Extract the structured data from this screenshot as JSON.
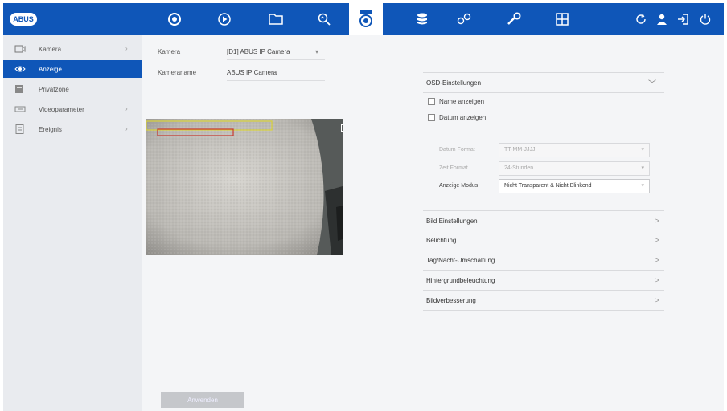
{
  "topbar": {
    "logo": "ABUS",
    "nav": [
      {
        "name": "camera-settings-icon"
      },
      {
        "name": "playback-icon"
      },
      {
        "name": "folder-icon"
      },
      {
        "name": "search-icon"
      },
      {
        "name": "webcam-icon",
        "active": true
      },
      {
        "name": "storage-icon"
      },
      {
        "name": "system-settings-icon"
      },
      {
        "name": "maintenance-icon"
      },
      {
        "name": "layout-icon"
      }
    ],
    "right_icons": [
      "refresh-icon",
      "user-icon",
      "logout-icon",
      "power-icon"
    ]
  },
  "sidebar": {
    "items": [
      {
        "label": "Kamera",
        "icon": "camera-icon",
        "chevron": "›",
        "active": false
      },
      {
        "label": "Anzeige",
        "icon": "eye-icon",
        "chevron": "",
        "active": true
      },
      {
        "label": "Privatzone",
        "icon": "privacy-zone-icon",
        "chevron": "",
        "active": false
      },
      {
        "label": "Videoparameter",
        "icon": "video-params-icon",
        "chevron": "›",
        "active": false
      },
      {
        "label": "Ereignis",
        "icon": "event-icon",
        "chevron": "›",
        "active": false
      }
    ]
  },
  "main": {
    "camera_label": "Kamera",
    "camera_value": "[D1] ABUS IP Camera",
    "camera_arrow": "▾",
    "camera_name_label": "Kameraname",
    "camera_name_value": "ABUS IP Camera",
    "save_label": "Anwenden"
  },
  "osd": {
    "title": "OSD-Einstellungen",
    "arrow": "﹀",
    "show_name": "Name anzeigen",
    "show_date": "Datum anzeigen",
    "date_format_label": "Datum Format",
    "date_format_value": "TT-MM-JJJJ",
    "time_format_label": "Zeit Format",
    "time_format_value": "24-Stunden",
    "display_mode_label": "Anzeige Modus",
    "display_mode_value": "Nicht Transparent & Nicht Blinkend",
    "select_arrow": "▾"
  },
  "sections": [
    {
      "label": "Bild Einstellungen",
      "arrow": ">"
    },
    {
      "label": "Belichtung",
      "arrow": ">"
    },
    {
      "label": "Tag/Nacht-Umschaltung",
      "arrow": ">"
    },
    {
      "label": "Hintergrundbeleuchtung",
      "arrow": ">"
    },
    {
      "label": "Bildverbesserung",
      "arrow": ">"
    }
  ],
  "colors": {
    "accent": "#0f56b8",
    "osd_name_box": "#d9d33a",
    "osd_date_box": "#c8372e"
  }
}
